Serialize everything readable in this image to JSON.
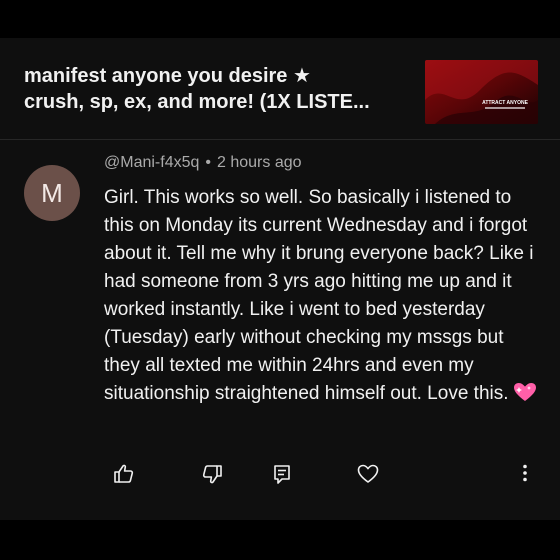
{
  "video": {
    "title": "manifest anyone you desire ★\ncrush, sp, ex, and more! (1X LISTE...",
    "thumbnail_text": "ATTRACT ANYONE"
  },
  "comment": {
    "avatar_letter": "M",
    "author": "@Mani-f4x5q",
    "separator": "•",
    "time": "2 hours ago",
    "text": "Girl. This works so well. So basically i listened to this on Monday its current Wednesday and i forgot about it. Tell me why it brung everyone back? Like i had someone from 3 yrs ago hitting me up and it worked instantly. Like i went to bed yesterday (Tuesday) early without checking my mssgs but they all texted me within 24hrs and even my situationship straightened himself out. Love this.",
    "emoji": "sparkling-heart"
  },
  "actions": {
    "icons": [
      "thumbs-up-icon",
      "thumbs-down-icon",
      "reply-icon",
      "heart-icon",
      "more-vertical-icon"
    ]
  },
  "colors": {
    "background": "#0f0f0f",
    "text": "#f1f1f1",
    "meta": "#aaaaaa",
    "avatar": "#6b5049",
    "emoji": "#ff5fa8"
  }
}
